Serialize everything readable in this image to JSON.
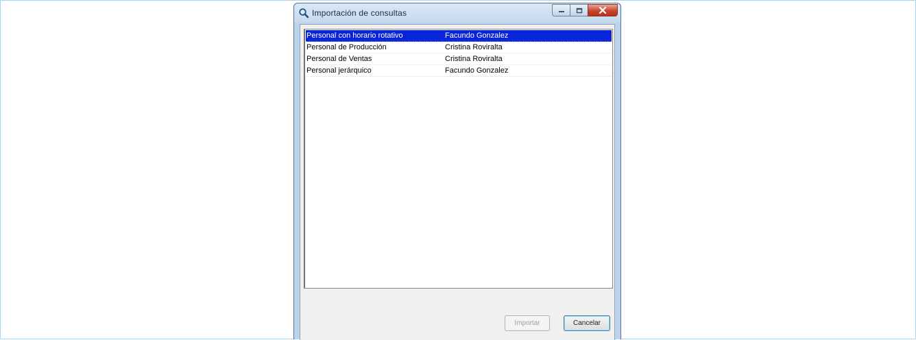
{
  "window": {
    "title": "Importación de consultas",
    "icon": "magnifier-icon"
  },
  "list": {
    "rows": [
      {
        "name": "Personal con horario rotativo",
        "owner": "Facundo Gonzalez",
        "selected": true
      },
      {
        "name": "Personal de Producción",
        "owner": "Cristina Roviralta",
        "selected": false
      },
      {
        "name": "Personal de Ventas",
        "owner": "Cristina Roviralta",
        "selected": false
      },
      {
        "name": "Personal jerárquico",
        "owner": "Facundo Gonzalez",
        "selected": false
      }
    ]
  },
  "buttons": {
    "import_label": "Importar",
    "cancel_label": "Cancelar"
  },
  "colors": {
    "selection": "#0a24d8",
    "window_frame": "#bcd3ea",
    "close_button": "#c7452e"
  }
}
